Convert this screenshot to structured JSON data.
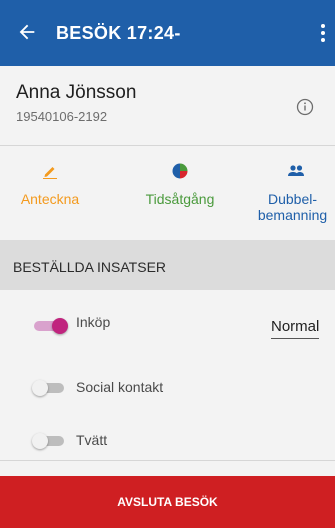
{
  "header": {
    "title": "BESÖK 17:24-",
    "back_icon": "arrow-left-icon",
    "menu_icon": "more-vertical-icon",
    "color": "#1f5fa9"
  },
  "patient": {
    "name": "Anna Jönsson",
    "personal_number": "19540106-2192",
    "info_icon": "info-icon"
  },
  "actions": [
    {
      "label": "Anteckna",
      "icon": "pencil-icon",
      "color": "#f39a1e"
    },
    {
      "label": "Tidsåtgång",
      "icon": "pie-chart-icon",
      "color": "#4a9a3c"
    },
    {
      "label_line1": "Dubbel-",
      "label_line2": "bemanning",
      "icon": "people-icon",
      "color": "#1f5fa9"
    }
  ],
  "section": {
    "title": "BESTÄLLDA INSATSER"
  },
  "services": [
    {
      "label": "Inköp",
      "enabled": true,
      "level": "Normal"
    },
    {
      "label": "Social kontakt",
      "enabled": false
    },
    {
      "label": "Tvätt",
      "enabled": false
    }
  ],
  "footer": {
    "button_label": "AVSLUTA BESÖK",
    "color": "#cf1f22"
  }
}
